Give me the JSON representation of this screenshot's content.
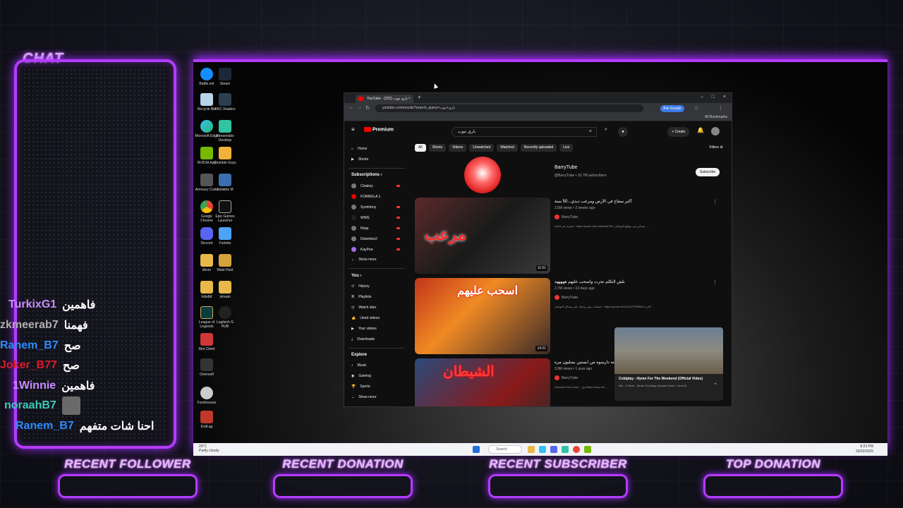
{
  "overlay": {
    "chat_title": "CHAT",
    "chat_messages": [
      {
        "user": "TurkixG1",
        "text": "فاهمين",
        "color": "#c98cff"
      },
      {
        "user": "zkmeerab7",
        "text": "فهمنا",
        "color": "#b0b0b0"
      },
      {
        "user": "Ranem_B7",
        "text": "صح",
        "color": "#2e8cff"
      },
      {
        "user": "Joker_B77",
        "text": "صح",
        "color": "#e0182b"
      },
      {
        "user": "1Winnie",
        "text": "فاهمين",
        "color": "#c98cff"
      },
      {
        "user": "noraahB7",
        "text": "",
        "color": "#3ec9b7"
      },
      {
        "user": "Ranem_B7",
        "text": "احنا شات متفهم",
        "color": "#2e8cff"
      }
    ],
    "bottom_labels": [
      "RECENT FOLLOWER",
      "RECENT DONATION",
      "RECENT SUBSCRIBER",
      "TOP DONATION"
    ],
    "accent_color": "#b43cff"
  },
  "desktop": {
    "icons": [
      "Battle.net",
      "Steam",
      "Recycle Bin",
      "ARC Raiders",
      "Microsoft Edge",
      "Streamlabs Desktop",
      "NVIDIA App",
      "Stumble Guys",
      "Armoury Crate",
      "Soilable M",
      "Google Chrome",
      "Epic Games Launcher",
      "Discord",
      "Fortnite",
      "driver",
      "Wast Hunt",
      "hdsdbf",
      "stream",
      "League of Legends",
      "Logitech G HUB",
      "Riot Client",
      "Overwolf",
      "Fxxxfxxxsss",
      "ExitLag"
    ],
    "taskbar": {
      "weather_temp": "29°C",
      "weather_desc": "Partly cloudy",
      "search": "Search",
      "time": "8:23 PM",
      "date": "26/02/2025"
    }
  },
  "browser": {
    "tab_title": "YouTube - باري تيوب (232)",
    "url": "youtube.com/results?search_query=باري+تيوب",
    "ask_google": "Ask Google",
    "all_bookmarks": "All Bookmarks"
  },
  "youtube": {
    "logo": "Premium",
    "search_value": "باري تيوب",
    "create": "Create",
    "chips": [
      "All",
      "Shorts",
      "Videos",
      "Unwatched",
      "Watched",
      "Recently uploaded",
      "Live"
    ],
    "filters": "Filters",
    "sidebar": {
      "main": [
        "Home",
        "Shorts"
      ],
      "subscriptions_head": "Subscriptions",
      "subscriptions": [
        "Cloakzy",
        "FORMULA 1",
        "Symfuhny",
        "WWE",
        "Ninja",
        "Distortion2",
        "KayPea"
      ],
      "show_more": "Show more",
      "you_head": "You",
      "you": [
        "History",
        "Playlists",
        "Watch later",
        "Liked videos",
        "Your videos",
        "Downloads"
      ],
      "explore_head": "Explore",
      "explore": [
        "Music",
        "Gaming",
        "Sports"
      ],
      "show_more2": "Show more"
    },
    "channel": {
      "name": "BarryTube",
      "handle": "@BarryTube • 10.7M subscribers",
      "subscribe": "Subscribe"
    },
    "videos": [
      {
        "title": "أكبر سفاح في الأرض ومرعب ديدي...50 سنة",
        "meta": "2.6M views • 2 weeks ago",
        "channel": "BarryTube",
        "desc": "اشترك في القناة : https://youtu.be/Lu0d9d8I70k | حسابي في مواقع التواصل ...",
        "duration": "11:51",
        "thumb_text": "مرعب"
      },
      {
        "title": "بلش التكلم تحرت واسحب عليهم هههههه",
        "meta": "2.7M views • 13 days ago",
        "channel": "BarryTube",
        "desc": "حسابات بيعي وحيال على وسائل التواصل : https://youtu.be/o3XQ7TN39NU | اكثر ...",
        "duration": "14:21",
        "thumb_text": "اسحب عليهم"
      },
      {
        "title": "ديدي نادي عشيقته دارسوه من ابستين بسليون مرة",
        "meta": "3.9M views • 1 year ago",
        "channel": "BarryTube",
        "desc": "Zessess Zero Zone - اول https://hoyo.lin ...",
        "duration": "",
        "thumb_text": "الشيطان"
      }
    ],
    "miniplayer": {
      "title": "Coldplay - Hymn For The Weekend (Official Video)",
      "sub": "Mix - C-Boot - Never Go Away (slowed down + reverb)"
    }
  }
}
